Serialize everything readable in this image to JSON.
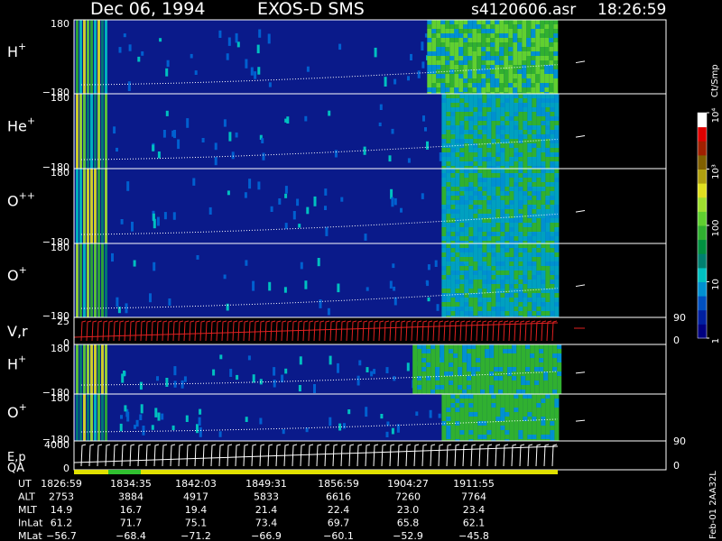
{
  "header": {
    "date": "Dec 06, 1994",
    "instrument": "EXOS-D SMS",
    "file": "s4120606.asr",
    "time": "18:26:59"
  },
  "colorbar": {
    "unit": "Ct/Smp",
    "tick_labels": [
      "1",
      "10",
      "100",
      "10³",
      "10⁴"
    ],
    "colors": [
      "#000080",
      "#0020a0",
      "#0050c0",
      "#0090d0",
      "#00c0c0",
      "#008070",
      "#009040",
      "#30b030",
      "#60d030",
      "#a0e030",
      "#e0e020",
      "#b0a010",
      "#806000",
      "#a02000",
      "#e00000",
      "#ffffff"
    ]
  },
  "side_label": "Feb-01 2AA32L",
  "colors": {
    "background": "#000000",
    "spectrogram_base": "#0a1a8a",
    "bright_band": "#60d030",
    "trace": "#ffffff",
    "velocity_trace": "#e02020",
    "qa_normal": "#e0e000",
    "qa_flag": "#30c030"
  },
  "chart_data": {
    "type": "heatmap",
    "title": "Dec 06, 1994   EXOS-D SMS",
    "x_axis": {
      "label": "UT",
      "ticks": [
        "1826:59",
        "1834:35",
        "1842:03",
        "1849:31",
        "1856:59",
        "1904:27",
        "1911:55"
      ]
    },
    "panels": [
      {
        "label": "H",
        "sup": "+",
        "y_top": "180",
        "y_bottom": "−180",
        "kind": "spectrogram",
        "bright_start": 0.73,
        "bright_color": "#60d030"
      },
      {
        "label": "He",
        "sup": "+",
        "y_top": "180",
        "y_bottom": "−180",
        "kind": "spectrogram",
        "bright_start": 0.76,
        "bright_color": "#00a0c0"
      },
      {
        "label": "O",
        "sup": "++",
        "y_top": "180",
        "y_bottom": "−180",
        "kind": "spectrogram",
        "bright_start": 0.76,
        "bright_color": "#00a0c0"
      },
      {
        "label": "O",
        "sup": "+",
        "y_top": "180",
        "y_bottom": "−180",
        "kind": "spectrogram",
        "bright_start": 0.76,
        "bright_color": "#00a0c0"
      },
      {
        "label": "V,r",
        "sup": "",
        "y_top": "25",
        "y_bottom": "0",
        "right_top": "90",
        "right_bottom": "0",
        "kind": "line"
      },
      {
        "label": "H",
        "sup": "+",
        "y_top": "180",
        "y_bottom": "−180",
        "kind": "spectrogram",
        "bright_start": 0.7,
        "bright_color": "#30b030"
      },
      {
        "label": "O",
        "sup": "+",
        "y_top": "180",
        "y_bottom": "−180",
        "kind": "spectrogram",
        "bright_start": 0.76,
        "bright_color": "#30b030"
      },
      {
        "label": "E,p",
        "label2": "QA",
        "sup": "",
        "y_top": "4000",
        "y_bottom": "0",
        "right_top": "90",
        "right_bottom": "0",
        "kind": "line"
      }
    ],
    "ephemeris": {
      "rows": [
        {
          "label": "UT",
          "values": [
            "1826:59",
            "1834:35",
            "1842:03",
            "1849:31",
            "1856:59",
            "1904:27",
            "1911:55"
          ]
        },
        {
          "label": "ALT",
          "values": [
            "2753",
            "3884",
            "4917",
            "5833",
            "6616",
            "7260",
            "7764"
          ]
        },
        {
          "label": "MLT",
          "values": [
            "14.9",
            "16.7",
            "19.4",
            "21.4",
            "22.4",
            "23.0",
            "23.4"
          ]
        },
        {
          "label": "InLat",
          "values": [
            "61.2",
            "71.7",
            "75.1",
            "73.4",
            "69.7",
            "65.8",
            "62.1"
          ]
        },
        {
          "label": "MLat",
          "values": [
            "−56.7",
            "−68.4",
            "−71.2",
            "−66.9",
            "−60.1",
            "−52.9",
            "−45.8"
          ]
        }
      ]
    }
  }
}
